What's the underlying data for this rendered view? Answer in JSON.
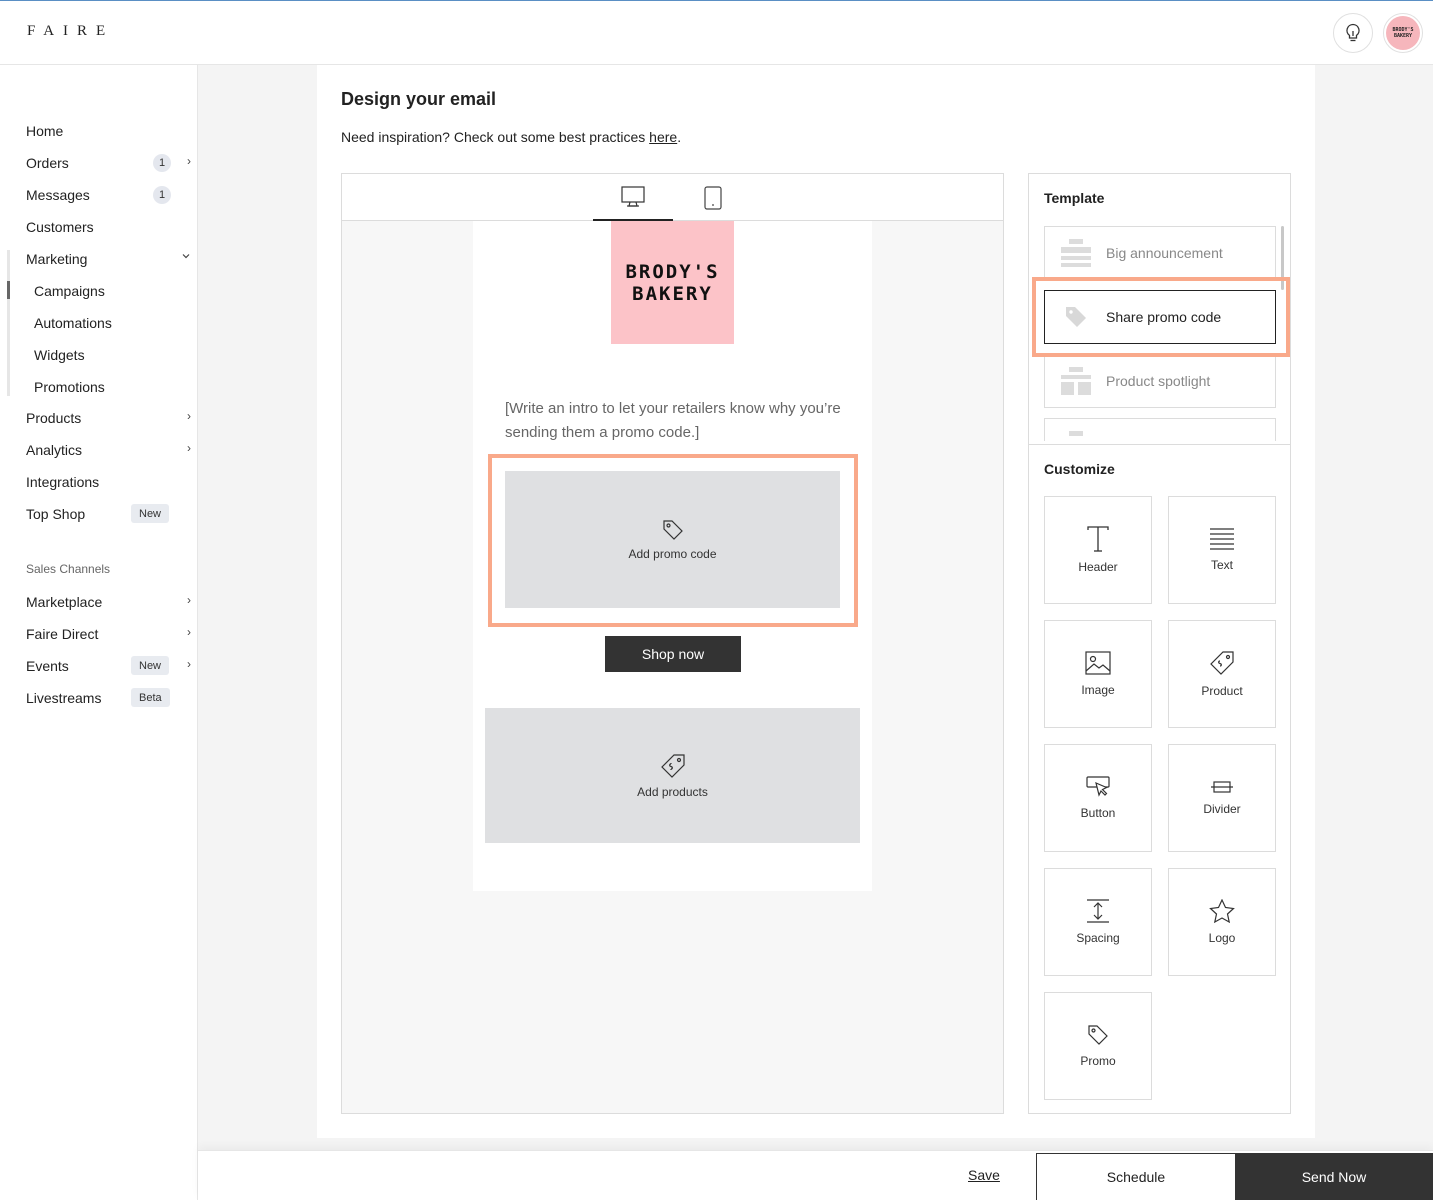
{
  "app": {
    "logo": "FAIRE"
  },
  "header": {
    "avatar_line1": "BRODY'S",
    "avatar_line2": "BAKERY"
  },
  "sidebar": {
    "items": [
      {
        "label": "Home"
      },
      {
        "label": "Orders",
        "badge": "1"
      },
      {
        "label": "Messages",
        "badge": "1"
      },
      {
        "label": "Customers"
      },
      {
        "label": "Marketing"
      },
      {
        "label": "Campaigns"
      },
      {
        "label": "Automations"
      },
      {
        "label": "Widgets"
      },
      {
        "label": "Promotions"
      },
      {
        "label": "Products"
      },
      {
        "label": "Analytics"
      },
      {
        "label": "Integrations"
      },
      {
        "label": "Top Shop",
        "tag": "New"
      }
    ],
    "section_label": "Sales Channels",
    "channels": [
      {
        "label": "Marketplace"
      },
      {
        "label": "Faire Direct"
      },
      {
        "label": "Events",
        "tag": "New"
      },
      {
        "label": "Livestreams",
        "tag": "Beta"
      }
    ]
  },
  "main": {
    "title": "Design your email",
    "inspiration_text": "Need inspiration? Check out some best practices ",
    "inspiration_link": "here",
    "inspiration_end": "."
  },
  "preview": {
    "brand_line1": "BRODY'S",
    "brand_line2": "BAKERY",
    "intro": "[Write an intro to let your retailers know why you’re sending them a promo code.]",
    "promo_label": "Add promo code",
    "shop_button": "Shop now",
    "products_label": "Add products"
  },
  "template_panel": {
    "title": "Template",
    "items": [
      {
        "label": "Big announcement"
      },
      {
        "label": "Share promo code",
        "selected": true
      },
      {
        "label": "Product spotlight"
      }
    ]
  },
  "customize_panel": {
    "title": "Customize",
    "tiles": [
      {
        "label": "Header",
        "icon": "header-icon"
      },
      {
        "label": "Text",
        "icon": "text-icon"
      },
      {
        "label": "Image",
        "icon": "image-icon"
      },
      {
        "label": "Product",
        "icon": "product-tag-icon"
      },
      {
        "label": "Button",
        "icon": "button-icon"
      },
      {
        "label": "Divider",
        "icon": "divider-icon"
      },
      {
        "label": "Spacing",
        "icon": "spacing-icon"
      },
      {
        "label": "Logo",
        "icon": "star-icon"
      },
      {
        "label": "Promo",
        "icon": "promo-tag-icon"
      }
    ]
  },
  "footer": {
    "save_label": "Save",
    "schedule_label": "Schedule",
    "send_label": "Send Now"
  },
  "colors": {
    "accent_highlight": "#f9a98a",
    "brand_pink": "#fcc3c8",
    "dark_button": "#333333"
  }
}
